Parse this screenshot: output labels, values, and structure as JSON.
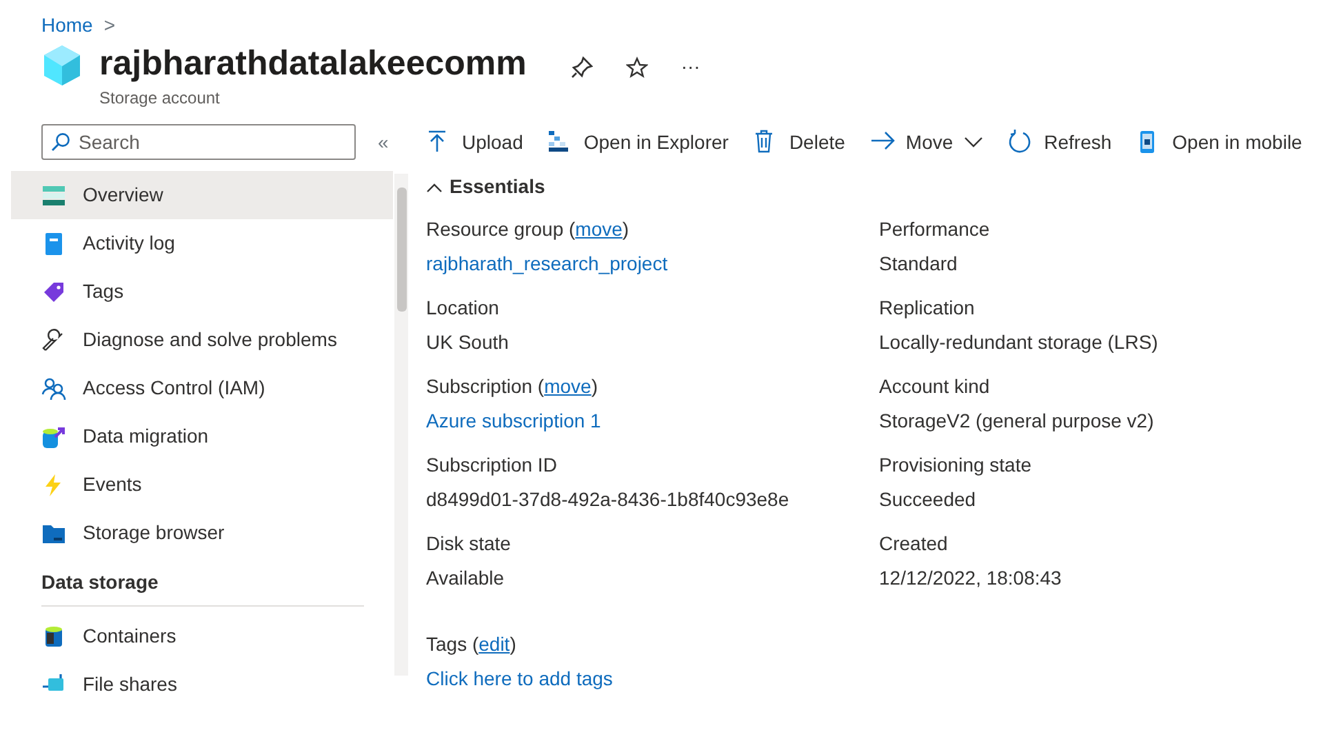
{
  "breadcrumb": {
    "items": [
      "Home"
    ],
    "separator": ">"
  },
  "header": {
    "title": "rajbharathdatalakeecomm",
    "subtitle": "Storage account",
    "more": "···"
  },
  "sidebar": {
    "search": {
      "placeholder": "Search"
    },
    "collapse": "«",
    "items": [
      {
        "label": "Overview",
        "selected": true
      },
      {
        "label": "Activity log",
        "selected": false
      },
      {
        "label": "Tags",
        "selected": false
      },
      {
        "label": "Diagnose and solve problems",
        "selected": false
      },
      {
        "label": "Access Control (IAM)",
        "selected": false
      },
      {
        "label": "Data migration",
        "selected": false
      },
      {
        "label": "Events",
        "selected": false
      },
      {
        "label": "Storage browser",
        "selected": false
      }
    ],
    "sections": [
      {
        "title": "Data storage",
        "items": [
          {
            "label": "Containers",
            "selected": false
          },
          {
            "label": "File shares",
            "selected": false
          }
        ]
      }
    ]
  },
  "toolbar": [
    {
      "label": "Upload"
    },
    {
      "label": "Open in Explorer"
    },
    {
      "label": "Delete"
    },
    {
      "label": "Move",
      "dropdown": true
    },
    {
      "label": "Refresh"
    },
    {
      "label": "Open in mobile"
    }
  ],
  "essentials": {
    "title": "Essentials",
    "expanded": true,
    "left": [
      {
        "label": "Resource group (",
        "link": "move",
        "label_end": ")",
        "value": "rajbharath_research_project",
        "value_is_link": true
      },
      {
        "label": "Location",
        "value": "UK South",
        "value_is_link": false
      },
      {
        "label": "Subscription (",
        "link": "move",
        "label_end": ")",
        "value": "Azure subscription 1",
        "value_is_link": true
      },
      {
        "label": "Subscription ID",
        "value": "d8499d01-37d8-492a-8436-1b8f40c93e8e",
        "value_is_link": false
      },
      {
        "label": "Disk state",
        "value": "Available",
        "value_is_link": false
      }
    ],
    "right": [
      {
        "label": "Performance",
        "value": "Standard",
        "value_is_link": false
      },
      {
        "label": "Replication",
        "value": "Locally-redundant storage (LRS)",
        "value_is_link": false
      },
      {
        "label": "Account kind",
        "value": "StorageV2 (general purpose v2)",
        "value_is_link": false
      },
      {
        "label": "Provisioning state",
        "value": "Succeeded",
        "value_is_link": false
      },
      {
        "label": "Created",
        "value": "12/12/2022, 18:08:43",
        "value_is_link": false
      }
    ],
    "tags": {
      "label": "Tags (",
      "link": "edit",
      "label_end": ")",
      "value": "Click here to add tags"
    }
  }
}
